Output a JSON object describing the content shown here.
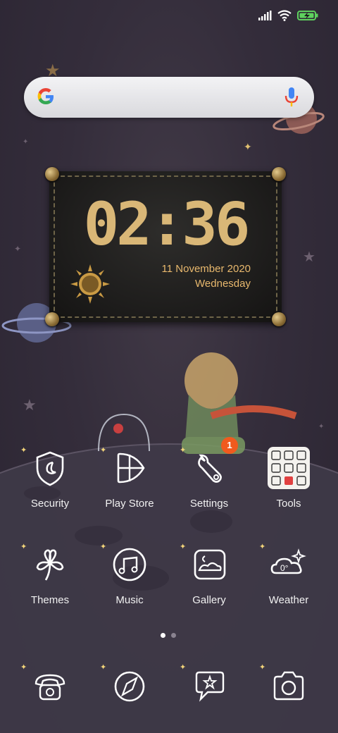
{
  "status_bar": {
    "icons": [
      "signal-icon",
      "wifi-icon",
      "battery-charging-icon"
    ],
    "battery_color": "#5ed25e"
  },
  "search": {
    "logo": "google-icon",
    "mic": "microphone-icon"
  },
  "clock_widget": {
    "time": "02:36",
    "date": "11 November 2020",
    "weekday": "Wednesday",
    "accent_color": "#e8b86d"
  },
  "apps": {
    "row1": [
      {
        "label": "Security",
        "icon": "shield-moon-icon"
      },
      {
        "label": "Play Store",
        "icon": "play-store-icon"
      },
      {
        "label": "Settings",
        "icon": "wrench-icon",
        "badge": "1"
      },
      {
        "label": "Tools",
        "icon": "tools-folder-icon"
      }
    ],
    "row2": [
      {
        "label": "Themes",
        "icon": "clover-icon"
      },
      {
        "label": "Music",
        "icon": "music-note-icon"
      },
      {
        "label": "Gallery",
        "icon": "gallery-icon"
      },
      {
        "label": "Weather",
        "icon": "weather-icon",
        "temp": "0°"
      }
    ]
  },
  "page_indicator": {
    "pages": 2,
    "active": 1
  },
  "dock": [
    {
      "icon": "phone-icon"
    },
    {
      "icon": "browser-icon"
    },
    {
      "icon": "messages-icon"
    },
    {
      "icon": "camera-icon"
    }
  ]
}
